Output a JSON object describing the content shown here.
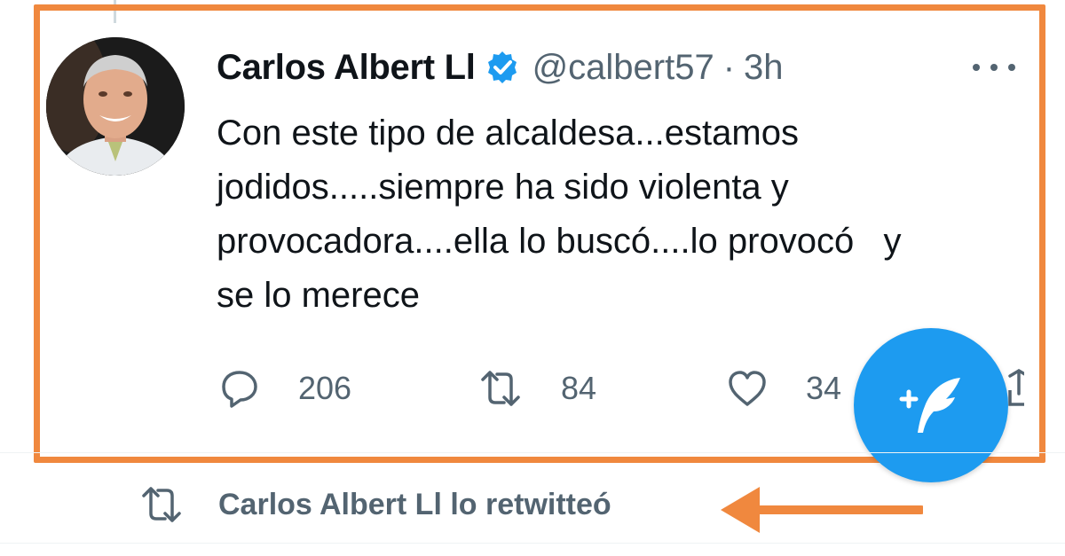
{
  "tweet": {
    "author_name": "Carlos Albert Ll",
    "handle": "@calbert57",
    "separator": "·",
    "time": "3h",
    "text_lines": [
      "Con este tipo de alcaldesa...estamos",
      "jodidos.....siempre ha sido violenta y",
      "provocadora....ella lo buscó....lo provocó   y",
      "se lo merece"
    ],
    "replies": "206",
    "retweets": "84",
    "likes": "34"
  },
  "retweet_banner": {
    "label": "Carlos Albert Ll lo retwitteó"
  },
  "icons": {
    "verified": "verified-badge-icon",
    "more": "more-dots-icon",
    "reply": "reply-icon",
    "retweet": "retweet-icon",
    "like": "heart-icon",
    "share": "share-icon",
    "compose": "compose-tweet-icon",
    "annotation_arrow": "arrow-left-icon"
  },
  "colors": {
    "annotation": "#f0883e",
    "accent": "#1d9bf0",
    "secondary_text": "#536471"
  }
}
